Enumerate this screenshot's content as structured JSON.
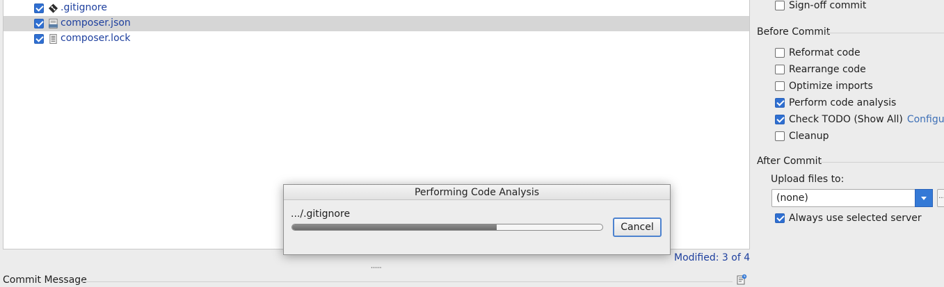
{
  "files": [
    {
      "name": ".gitignore",
      "checked": true,
      "icon": "git-icon",
      "selected": false
    },
    {
      "name": "composer.json",
      "checked": true,
      "icon": "json-icon",
      "selected": true
    },
    {
      "name": "composer.lock",
      "checked": true,
      "icon": "text-file-icon",
      "selected": false
    }
  ],
  "options": {
    "signoff_label": "Sign-off commit",
    "before_commit_title": "Before Commit",
    "reformat_label": "Reformat code",
    "rearrange_label": "Rearrange code",
    "optimize_label": "Optimize imports",
    "analysis_label": "Perform code analysis",
    "todo_label": "Check TODO (Show All)",
    "todo_configure_link": "Configure",
    "cleanup_label": "Cleanup",
    "after_commit_title": "After Commit",
    "upload_label": "Upload files to:",
    "upload_value": "(none)",
    "more_button": "...",
    "always_use_label": "Always use selected server"
  },
  "checks": {
    "signoff": false,
    "reformat": false,
    "rearrange": false,
    "optimize": false,
    "analysis": true,
    "todo": true,
    "cleanup": false,
    "always_use": true
  },
  "status": {
    "modified": "Modified: 3 of 4"
  },
  "commit": {
    "message_label": "Commit Message"
  },
  "dialog": {
    "title": "Performing Code Analysis",
    "current_file": ".../.gitignore",
    "progress_fraction": 0.66,
    "cancel_label": "Cancel"
  },
  "colors": {
    "accent": "#2f6fd1",
    "link": "#3d6fb6",
    "file_name": "#1d3f9e"
  }
}
